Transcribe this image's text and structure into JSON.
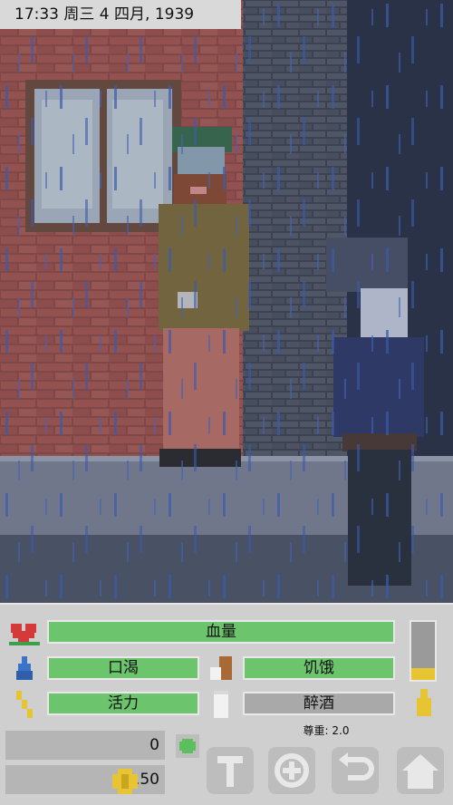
{
  "clock": {
    "text": "17:33 周三 4 四月, 1939"
  },
  "stats": {
    "health": {
      "label": "血量",
      "level": 1.0
    },
    "thirst": {
      "label": "口渴",
      "level": 1.0
    },
    "hunger": {
      "label": "饥饿",
      "level": 1.0
    },
    "energy": {
      "label": "活力",
      "level": 1.0
    },
    "drunk": {
      "label": "醉酒",
      "level": 0.0
    },
    "side_meter_level": 0.2
  },
  "respect": {
    "text": "尊重: 2.0"
  },
  "currency": {
    "bottles": {
      "value": "0"
    },
    "money": {
      "value": "2.50"
    }
  },
  "colors": {
    "bar_green": "#6cc46c",
    "bar_empty": "#a9a9a9",
    "hud_bg": "#cfcfcf",
    "accent_yellow": "#e7c431",
    "gem_green": "#5bbf5b"
  },
  "icons": [
    "heart-icon",
    "water-drop-icon",
    "bread-icon",
    "lightning-icon",
    "milk-icon",
    "bottle-icon",
    "shovel-icon",
    "target-icon",
    "back-arrow-icon",
    "home-icon"
  ]
}
